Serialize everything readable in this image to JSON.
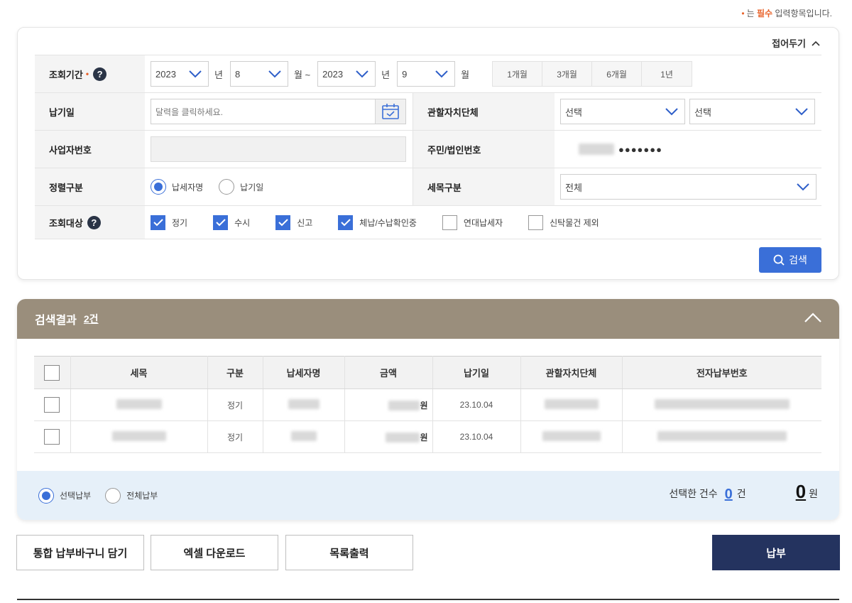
{
  "required_note": {
    "dot": "•",
    "prefix": "는 ",
    "req": "필수",
    "suffix": " 입력항목입니다."
  },
  "fold_label": "접어두기",
  "form": {
    "period": {
      "label": "조회기간",
      "req_dot": "•",
      "help": "?",
      "from_year": "2023",
      "from_month": "8",
      "to_year": "2023",
      "to_month": "9",
      "unit_year": "년",
      "unit_month_from": "월 ~",
      "unit_month_to": "월",
      "quick": [
        "1개월",
        "3개월",
        "6개월",
        "1년"
      ]
    },
    "due_date": {
      "label": "납기일",
      "placeholder": "달력을 클릭하세요."
    },
    "local_gov": {
      "label": "관할자치단체",
      "select1": "선택",
      "select2": "선택"
    },
    "biz_no": {
      "label": "사업자번호",
      "value": ""
    },
    "resident_no": {
      "label": "주민/법인번호",
      "masked": "●●●●●●●"
    },
    "sort": {
      "label": "정렬구분",
      "options": [
        "납세자명",
        "납기일"
      ],
      "selected": 0
    },
    "tax_item": {
      "label": "세목구분",
      "value": "전체"
    },
    "target": {
      "label": "조회대상",
      "help": "?",
      "options": [
        {
          "label": "정기",
          "checked": true
        },
        {
          "label": "수시",
          "checked": true
        },
        {
          "label": "신고",
          "checked": true
        },
        {
          "label": "체납/수납확인중",
          "checked": true
        },
        {
          "label": "연대납세자",
          "checked": false
        },
        {
          "label": "신탁물건 제외",
          "checked": false
        }
      ]
    },
    "search_label": "검색"
  },
  "results": {
    "title": "검색결과",
    "count": "2건",
    "headers": [
      "세목",
      "구분",
      "납세자명",
      "금액",
      "납기일",
      "관할자치단체",
      "전자납부번호"
    ],
    "rows": [
      {
        "type": "정기",
        "won": "원",
        "due": "23.10.04"
      },
      {
        "type": "정기",
        "won": "원",
        "due": "23.10.04"
      }
    ],
    "pay_modes": [
      "선택납부",
      "전체납부"
    ],
    "selected_mode": 0,
    "selected_count_label": "선택한 건수",
    "selected_count": "0",
    "count_unit": "건",
    "total": "0",
    "total_unit": "원"
  },
  "buttons": {
    "basket": "통합 납부바구니 담기",
    "excel": "엑셀 다운로드",
    "print": "목록출력",
    "pay": "납부"
  },
  "colors": {
    "accent": "#3a6fd8",
    "header_bar": "#9a8e7c",
    "pay_button": "#24335f",
    "required": "#e8632b"
  }
}
